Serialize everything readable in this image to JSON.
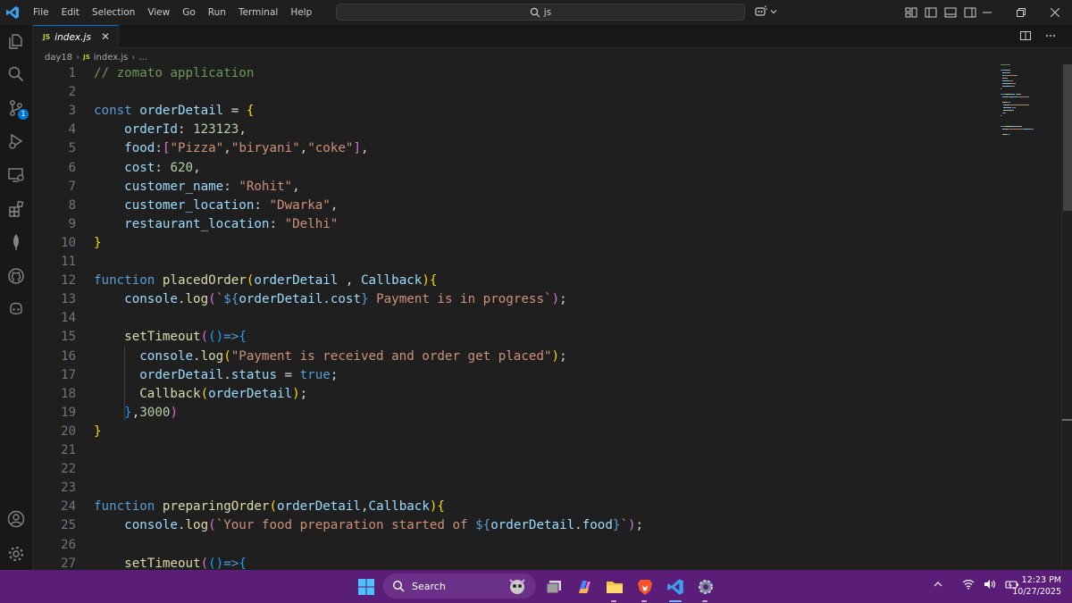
{
  "titlebar": {
    "menus": [
      "File",
      "Edit",
      "Selection",
      "View",
      "Go",
      "Run",
      "Terminal",
      "Help"
    ],
    "search_text": "js"
  },
  "activity": {
    "source_control_badge": "1"
  },
  "tab": {
    "icon": "JS",
    "label": "index.js",
    "close": "✕"
  },
  "breadcrumb": {
    "folder": "day18",
    "icon": "JS",
    "file": "index.js",
    "more": "..."
  },
  "colors": {
    "accent": "#0078d4",
    "editor_bg": "#1f1f1f",
    "taskbar": "#5b1e78"
  },
  "code_lines": [
    [
      [
        "t-cmt",
        "// zomato application"
      ]
    ],
    [],
    [
      [
        "t-kw",
        "const "
      ],
      [
        "t-var",
        "orderDetail"
      ],
      [
        "t-plain",
        " = "
      ],
      [
        "t-b1",
        "{"
      ]
    ],
    [
      [
        "t-plain",
        "    "
      ],
      [
        "t-var",
        "orderId"
      ],
      [
        "t-plain",
        ": "
      ],
      [
        "t-num",
        "123123"
      ],
      [
        "t-plain",
        ","
      ]
    ],
    [
      [
        "t-plain",
        "    "
      ],
      [
        "t-var",
        "food"
      ],
      [
        "t-plain",
        ":"
      ],
      [
        "t-b2",
        "["
      ],
      [
        "t-str",
        "\"Pizza\""
      ],
      [
        "t-plain",
        ","
      ],
      [
        "t-str",
        "\"biryani\""
      ],
      [
        "t-plain",
        ","
      ],
      [
        "t-str",
        "\"coke\""
      ],
      [
        "t-b2",
        "]"
      ],
      [
        "t-plain",
        ","
      ]
    ],
    [
      [
        "t-plain",
        "    "
      ],
      [
        "t-var",
        "cost"
      ],
      [
        "t-plain",
        ": "
      ],
      [
        "t-num",
        "620"
      ],
      [
        "t-plain",
        ","
      ]
    ],
    [
      [
        "t-plain",
        "    "
      ],
      [
        "t-var",
        "customer_name"
      ],
      [
        "t-plain",
        ": "
      ],
      [
        "t-str",
        "\"Rohit\""
      ],
      [
        "t-plain",
        ","
      ]
    ],
    [
      [
        "t-plain",
        "    "
      ],
      [
        "t-var",
        "customer_location"
      ],
      [
        "t-plain",
        ": "
      ],
      [
        "t-str",
        "\"Dwarka\""
      ],
      [
        "t-plain",
        ","
      ]
    ],
    [
      [
        "t-plain",
        "    "
      ],
      [
        "t-var",
        "restaurant_location"
      ],
      [
        "t-plain",
        ": "
      ],
      [
        "t-str",
        "\"Delhi\""
      ]
    ],
    [
      [
        "t-b1",
        "}"
      ]
    ],
    [],
    [
      [
        "t-kw",
        "function "
      ],
      [
        "t-fn",
        "placedOrder"
      ],
      [
        "t-b1",
        "("
      ],
      [
        "t-var",
        "orderDetail"
      ],
      [
        "t-plain",
        " , "
      ],
      [
        "t-var",
        "Callback"
      ],
      [
        "t-b1",
        ")"
      ],
      [
        "t-b1",
        "{"
      ]
    ],
    [
      [
        "t-plain",
        "    "
      ],
      [
        "t-var",
        "console"
      ],
      [
        "t-plain",
        "."
      ],
      [
        "t-fn",
        "log"
      ],
      [
        "t-b2",
        "("
      ],
      [
        "t-str",
        "`"
      ],
      [
        "t-kw",
        "${"
      ],
      [
        "t-var",
        "orderDetail"
      ],
      [
        "t-plain",
        "."
      ],
      [
        "t-var",
        "cost"
      ],
      [
        "t-kw",
        "}"
      ],
      [
        "t-str",
        " Payment is in progress`"
      ],
      [
        "t-b2",
        ")"
      ],
      [
        "t-plain",
        ";"
      ]
    ],
    [],
    [
      [
        "t-plain",
        "    "
      ],
      [
        "t-fn",
        "setTimeout"
      ],
      [
        "t-b2",
        "("
      ],
      [
        "t-b3",
        "()"
      ],
      [
        "t-kw",
        "=>"
      ],
      [
        "t-b3",
        "{"
      ]
    ],
    [
      [
        "t-plain",
        "      "
      ],
      [
        "t-var",
        "console"
      ],
      [
        "t-plain",
        "."
      ],
      [
        "t-fn",
        "log"
      ],
      [
        "t-b1",
        "("
      ],
      [
        "t-str",
        "\"Payment is received and order get placed\""
      ],
      [
        "t-b1",
        ")"
      ],
      [
        "t-plain",
        ";"
      ]
    ],
    [
      [
        "t-plain",
        "      "
      ],
      [
        "t-var",
        "orderDetail"
      ],
      [
        "t-plain",
        "."
      ],
      [
        "t-var",
        "status"
      ],
      [
        "t-plain",
        " = "
      ],
      [
        "t-kw",
        "true"
      ],
      [
        "t-plain",
        ";"
      ]
    ],
    [
      [
        "t-plain",
        "      "
      ],
      [
        "t-fn",
        "Callback"
      ],
      [
        "t-b1",
        "("
      ],
      [
        "t-var",
        "orderDetail"
      ],
      [
        "t-b1",
        ")"
      ],
      [
        "t-plain",
        ";"
      ]
    ],
    [
      [
        "t-plain",
        "    "
      ],
      [
        "t-b3",
        "}"
      ],
      [
        "t-plain",
        ","
      ],
      [
        "t-num",
        "3000"
      ],
      [
        "t-b2",
        ")"
      ]
    ],
    [
      [
        "t-b1",
        "}"
      ]
    ],
    [],
    [],
    [],
    [
      [
        "t-kw",
        "function "
      ],
      [
        "t-fn",
        "preparingOrder"
      ],
      [
        "t-b1",
        "("
      ],
      [
        "t-var",
        "orderDetail"
      ],
      [
        "t-plain",
        ","
      ],
      [
        "t-var",
        "Callback"
      ],
      [
        "t-b1",
        ")"
      ],
      [
        "t-b1",
        "{"
      ]
    ],
    [
      [
        "t-plain",
        "    "
      ],
      [
        "t-var",
        "console"
      ],
      [
        "t-plain",
        "."
      ],
      [
        "t-fn",
        "log"
      ],
      [
        "t-b2",
        "("
      ],
      [
        "t-str",
        "`Your food preparation started of "
      ],
      [
        "t-kw",
        "${"
      ],
      [
        "t-var",
        "orderDetail"
      ],
      [
        "t-plain",
        "."
      ],
      [
        "t-var",
        "food"
      ],
      [
        "t-kw",
        "}"
      ],
      [
        "t-str",
        "`"
      ],
      [
        "t-b2",
        ")"
      ],
      [
        "t-plain",
        ";"
      ]
    ],
    [],
    [
      [
        "t-plain",
        "    "
      ],
      [
        "t-fn",
        "setTimeout"
      ],
      [
        "t-b2",
        "("
      ],
      [
        "t-b3",
        "()"
      ],
      [
        "t-kw",
        "=>"
      ],
      [
        "t-b3",
        "{"
      ]
    ]
  ],
  "taskbar": {
    "search_label": "Search"
  },
  "clock": {
    "time": "12:23 PM",
    "date": "10/27/2025"
  }
}
